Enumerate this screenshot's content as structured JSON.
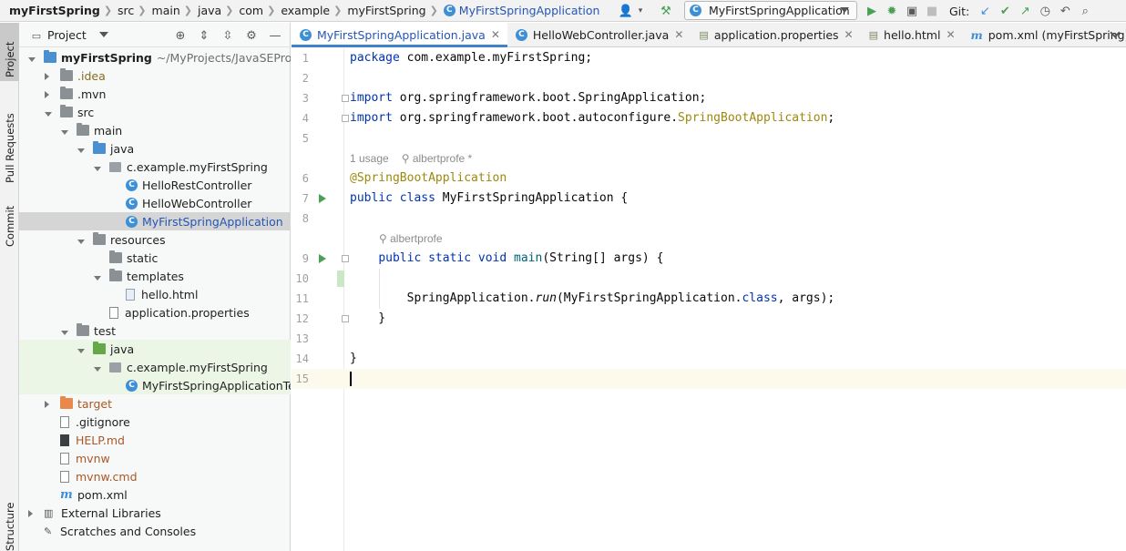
{
  "breadcrumbs": [
    "myFirstSpring",
    "src",
    "main",
    "java",
    "com",
    "example",
    "myFirstSpring",
    "MyFirstSpringApplication"
  ],
  "run_config": "MyFirstSpringApplication",
  "git_label": "Git:",
  "left_strip": [
    "Project",
    "Pull Requests",
    "Commit",
    "Structure"
  ],
  "project_panel": {
    "title": "Project",
    "tree": [
      {
        "label": "myFirstSpring",
        "path": "~/MyProjects/JavaSEProjects/C",
        "type": "folder-blue",
        "indent": 0,
        "expand": "open"
      },
      {
        "label": ".idea",
        "type": "folder",
        "indent": 1,
        "expand": "closed",
        "color": "brown"
      },
      {
        "label": ".mvn",
        "type": "folder",
        "indent": 1,
        "expand": "closed"
      },
      {
        "label": "src",
        "type": "folder",
        "indent": 1,
        "expand": "open"
      },
      {
        "label": "main",
        "type": "folder",
        "indent": 2,
        "expand": "open"
      },
      {
        "label": "java",
        "type": "folder-blue",
        "indent": 3,
        "expand": "open"
      },
      {
        "label": "c.example.myFirstSpring",
        "type": "package",
        "indent": 4,
        "expand": "open"
      },
      {
        "label": "HelloRestController",
        "type": "class",
        "indent": 5,
        "expand": "none"
      },
      {
        "label": "HelloWebController",
        "type": "class",
        "indent": 5,
        "expand": "none"
      },
      {
        "label": "MyFirstSpringApplication",
        "type": "class",
        "indent": 5,
        "expand": "none",
        "selected": true
      },
      {
        "label": "resources",
        "type": "folder",
        "indent": 3,
        "expand": "open"
      },
      {
        "label": "static",
        "type": "folder",
        "indent": 4,
        "expand": "none"
      },
      {
        "label": "templates",
        "type": "folder",
        "indent": 4,
        "expand": "open"
      },
      {
        "label": "hello.html",
        "type": "file-html",
        "indent": 5,
        "expand": "none"
      },
      {
        "label": "application.properties",
        "type": "file",
        "indent": 4,
        "expand": "none"
      },
      {
        "label": "test",
        "type": "folder",
        "indent": 2,
        "expand": "open"
      },
      {
        "label": "java",
        "type": "folder-green",
        "indent": 3,
        "expand": "open",
        "test": true
      },
      {
        "label": "c.example.myFirstSpring",
        "type": "package",
        "indent": 4,
        "expand": "open",
        "test": true
      },
      {
        "label": "MyFirstSpringApplicationTests",
        "type": "class",
        "indent": 5,
        "expand": "none",
        "test": true
      },
      {
        "label": "target",
        "type": "folder-orange",
        "indent": 1,
        "expand": "closed",
        "color": "orange"
      },
      {
        "label": ".gitignore",
        "type": "file",
        "indent": 1,
        "expand": "none"
      },
      {
        "label": "HELP.md",
        "type": "file-md",
        "indent": 1,
        "expand": "none",
        "color": "orange"
      },
      {
        "label": "mvnw",
        "type": "file",
        "indent": 1,
        "expand": "none",
        "color": "orange"
      },
      {
        "label": "mvnw.cmd",
        "type": "file",
        "indent": 1,
        "expand": "none",
        "color": "orange"
      },
      {
        "label": "pom.xml",
        "type": "maven",
        "indent": 1,
        "expand": "none"
      },
      {
        "label": "External Libraries",
        "type": "libs",
        "indent": 0,
        "expand": "closed"
      },
      {
        "label": "Scratches and Consoles",
        "type": "scratch",
        "indent": 0,
        "expand": "none"
      }
    ]
  },
  "tabs": [
    {
      "label": "MyFirstSpringApplication.java",
      "icon": "class-icon",
      "active": true
    },
    {
      "label": "HelloWebController.java",
      "icon": "class-icon"
    },
    {
      "label": "application.properties",
      "icon": "file-icon"
    },
    {
      "label": "hello.html",
      "icon": "html-icon"
    },
    {
      "label": "pom.xml (myFirstSpring)",
      "icon": "maven-icon"
    }
  ],
  "editor": {
    "hints": {
      "usage": "1 usage",
      "author": "albertprofe *",
      "author2": "albertprofe"
    },
    "lines": [
      {
        "n": "1",
        "code": [
          [
            "kw",
            "package"
          ],
          [
            "t",
            " com.example.myFirstSpring;"
          ]
        ]
      },
      {
        "n": "2",
        "code": []
      },
      {
        "n": "3",
        "code": [
          [
            "kw",
            "import"
          ],
          [
            "t",
            " org.springframework.boot.SpringApplication;"
          ]
        ]
      },
      {
        "n": "4",
        "code": [
          [
            "kw",
            "import"
          ],
          [
            "t",
            " org.springframework.boot.autoconfigure."
          ],
          [
            "ann",
            "SpringBootApplication"
          ],
          [
            "t",
            ";"
          ]
        ]
      },
      {
        "n": "5",
        "code": []
      },
      {
        "n": "6",
        "code": [
          [
            "ann",
            "@SpringBootApplication"
          ]
        ]
      },
      {
        "n": "7",
        "code": [
          [
            "kw",
            "public class"
          ],
          [
            "t",
            " MyFirstSpringApplication {"
          ]
        ]
      },
      {
        "n": "8",
        "code": []
      },
      {
        "n": "9",
        "code": [
          [
            "t",
            "    "
          ],
          [
            "kw",
            "public static void"
          ],
          [
            "t",
            " "
          ],
          [
            "fn",
            "main"
          ],
          [
            "t",
            "(String[] args) {"
          ]
        ]
      },
      {
        "n": "10",
        "code": []
      },
      {
        "n": "11",
        "code": [
          [
            "t",
            "        SpringApplication."
          ],
          [
            "it",
            "run"
          ],
          [
            "t",
            "(MyFirstSpringApplication."
          ],
          [
            "kw",
            "class"
          ],
          [
            "t",
            ", args);"
          ]
        ]
      },
      {
        "n": "12",
        "code": [
          [
            "t",
            "    }"
          ]
        ]
      },
      {
        "n": "13",
        "code": []
      },
      {
        "n": "14",
        "code": [
          [
            "t",
            "}"
          ]
        ]
      },
      {
        "n": "15",
        "code": []
      }
    ]
  }
}
